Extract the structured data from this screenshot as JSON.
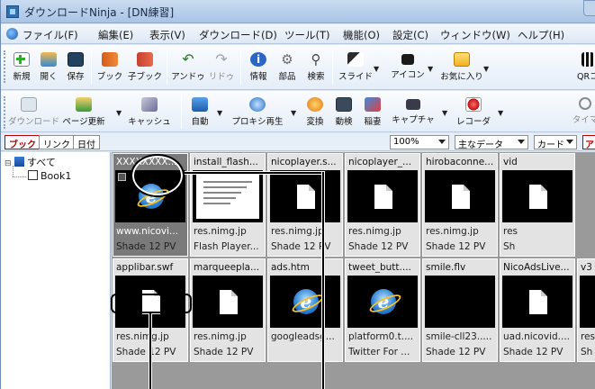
{
  "window": {
    "title": "ダウンロードNinja - [DN練習]"
  },
  "menu": [
    "ファイル(F)",
    "編集(E)",
    "表示(V)",
    "ダウンロード(D)",
    "ツール(T)",
    "機能(O)",
    "設定(C)",
    "ウィンドウ(W)",
    "ヘルプ(H)"
  ],
  "toolbar1": {
    "new": "新規",
    "open": "開く",
    "save": "保存",
    "book": "ブック",
    "child_book": "子ブック",
    "undo": "アンドゥ",
    "redo": "リドゥ",
    "info": "情報",
    "parts": "部品",
    "search": "検索",
    "slide": "スライド",
    "icon": "アイコン",
    "favorites": "お気に入り",
    "qr": "QRコー"
  },
  "toolbar2": {
    "download": "ダウンロード",
    "page_update": "ページ更新",
    "cache": "キャッシュ",
    "auto": "自動",
    "proxy_play": "プロキシ再生",
    "convert": "変換",
    "video_search": "動検",
    "inazuma": "稲妻",
    "capture": "キャプチャ",
    "recorder": "レコーダ",
    "timer": "タイマ"
  },
  "tabs": {
    "book": "ブック",
    "link": "リンク",
    "date": "日付"
  },
  "view": {
    "zoom": "100%",
    "data_mode": "主なデータ",
    "card": "カード",
    "extra": "ア"
  },
  "tree": {
    "root": "すべて",
    "child": "Book1"
  },
  "cards": [
    {
      "name": "XXXXXXXX....",
      "host": "www.nicovi...",
      "desc": "Shade 12 PV",
      "thumb": "ie",
      "selected": true
    },
    {
      "name": "install_flash...",
      "host": "res.nimg.jp",
      "desc": "Flash Player...",
      "thumb": "flash",
      "selected": false
    },
    {
      "name": "nicoplayer.s...",
      "host": "res.nimg.jp",
      "desc": "Shade 12 PV",
      "thumb": "doc",
      "selected": false
    },
    {
      "name": "nicoplayer_...",
      "host": "res.nimg.jp",
      "desc": "Shade 12 PV",
      "thumb": "doc",
      "selected": false
    },
    {
      "name": "hirobaconne...",
      "host": "res.nimg.jp",
      "desc": "Shade 12 PV",
      "thumb": "doc",
      "selected": false
    },
    {
      "name": "vid",
      "host": "res",
      "desc": "Sh",
      "thumb": "doc",
      "selected": false
    },
    {
      "name": "applibar.swf",
      "host": "res.nimg.jp",
      "desc": "Shade 12 PV",
      "thumb": "doc",
      "selected": false
    },
    {
      "name": "marqueepla...",
      "host": "res.nimg.jp",
      "desc": "Shade 12 PV",
      "thumb": "doc",
      "selected": false
    },
    {
      "name": "ads.htm",
      "host": "googleadsg...",
      "desc": "",
      "thumb": "ie",
      "selected": false
    },
    {
      "name": "tweet_butt....",
      "host": "platform0.t....",
      "desc": "Twitter For ...",
      "thumb": "ie",
      "selected": false
    },
    {
      "name": "smile.flv",
      "host": "smile-cll23.....",
      "desc": "Shade 12 PV",
      "thumb": "black",
      "selected": false
    },
    {
      "name": "NicoAdsLive...",
      "host": "uad.nicovid....",
      "desc": "Shade 12 PV",
      "thumb": "doc",
      "selected": false
    },
    {
      "name": "v3",
      "host": "res",
      "desc": "Sh",
      "thumb": "doc",
      "selected": false
    }
  ]
}
